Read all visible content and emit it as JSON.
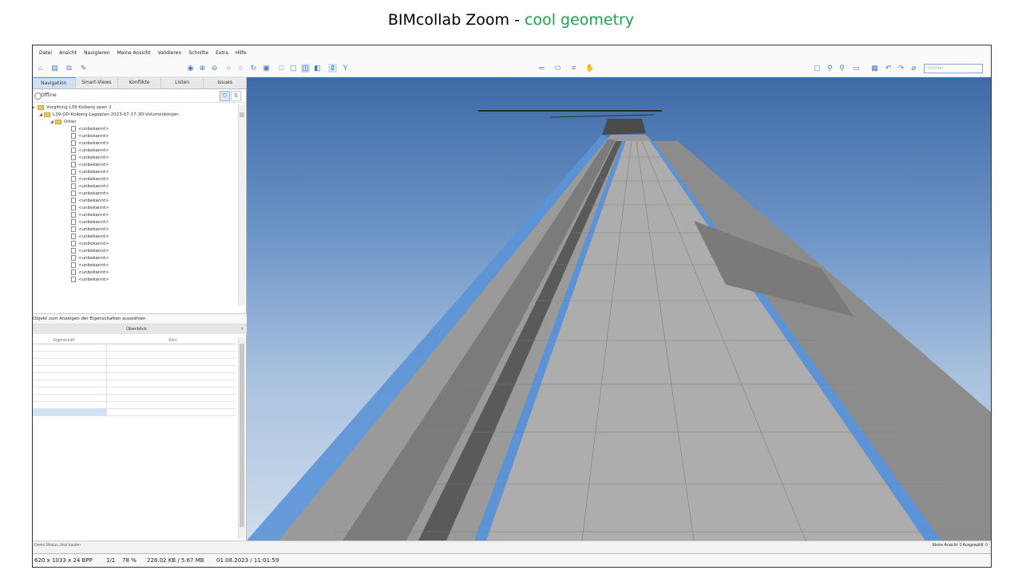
{
  "slide": {
    "title_prefix": "BIMcollab Zoom - ",
    "title_accent": "cool geometry",
    "accent_color": "#1aa34a"
  },
  "app": {
    "menu": [
      "Datei",
      "Ansicht",
      "Navigieren",
      "Meine Ansicht",
      "Validieren",
      "Schnitte",
      "Extra",
      "Hilfe"
    ],
    "search_placeholder": "Suchen",
    "tabs": [
      "Navigation",
      "Smart-Views",
      "Konflikte",
      "Listen",
      "Issues"
    ],
    "active_tab": "Navigation",
    "connection_status": "Offline",
    "tree": {
      "project": "Vorgitting L39 Kolberg open 2",
      "model": "L39-OD-Kolberg-Lageplan-2023-07-17-3D-Volumenkörper.",
      "group": "Other",
      "item_label": "<unbekannt>",
      "item_count": 22
    },
    "properties": {
      "hint": "Objekt zum Anzeigen der Eigenschaften auswählen",
      "tab": "Überblick",
      "col_property": "Eigenschaft",
      "col_value": "Wert"
    },
    "status_left": "Demo Modus   Jetzt kaufen",
    "status_right": "Meine Ansicht: 0  Ausgewählt: 0"
  },
  "viewer_status": {
    "dims": "620 x 1033 x 24 BPP",
    "page": "1/1",
    "zoom": "78 %",
    "size": "228.02 KB / 5.67 MB",
    "datetime": "01.08.2023 / 11:01:59"
  },
  "colors": {
    "sky_top": "#3e6aa6",
    "sky_bottom": "#cfdcec",
    "geometry_gray": "#8e8e8e",
    "geometry_blue": "#5a93d8"
  }
}
